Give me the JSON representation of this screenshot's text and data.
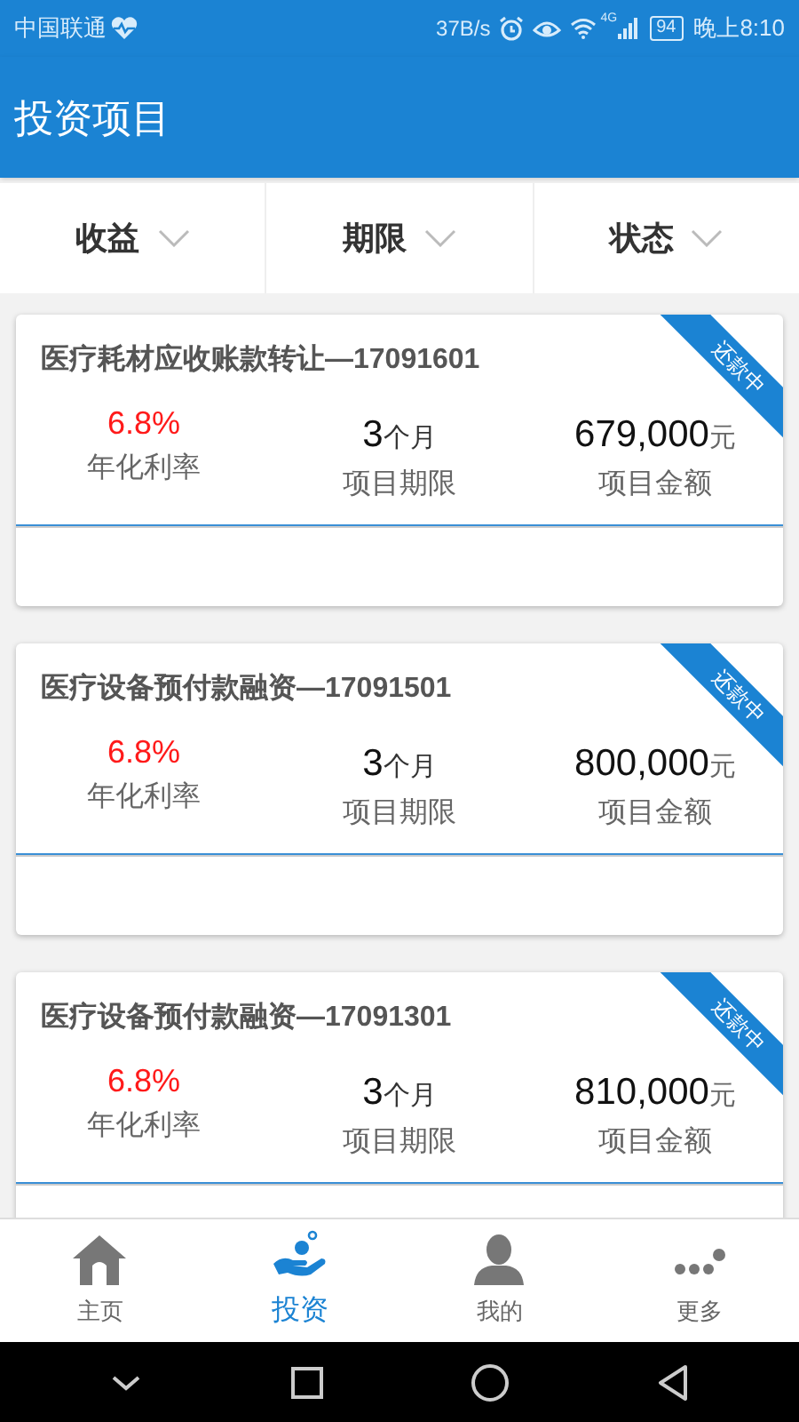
{
  "status_bar": {
    "carrier": "中国联通",
    "speed": "37B/s",
    "network": "4G",
    "battery": "94",
    "time": "晚上8:10"
  },
  "header": {
    "title": "投资项目"
  },
  "filters": [
    {
      "label": "收益"
    },
    {
      "label": "期限"
    },
    {
      "label": "状态"
    }
  ],
  "projects": [
    {
      "title": "医疗耗材应收账款转让—17091601",
      "status": "还款中",
      "rate": "6.8%",
      "rate_label": "年化利率",
      "term": "3",
      "term_unit": "个月",
      "term_label": "项目期限",
      "amount": "679,000",
      "amount_unit": "元",
      "amount_label": "项目金额"
    },
    {
      "title": "医疗设备预付款融资—17091501",
      "status": "还款中",
      "rate": "6.8%",
      "rate_label": "年化利率",
      "term": "3",
      "term_unit": "个月",
      "term_label": "项目期限",
      "amount": "800,000",
      "amount_unit": "元",
      "amount_label": "项目金额"
    },
    {
      "title": "医疗设备预付款融资—17091301",
      "status": "还款中",
      "rate": "6.8%",
      "rate_label": "年化利率",
      "term": "3",
      "term_unit": "个月",
      "term_label": "项目期限",
      "amount": "810,000",
      "amount_unit": "元",
      "amount_label": "项目金额"
    }
  ],
  "bottom_nav": [
    {
      "label": "主页",
      "selected": false
    },
    {
      "label": "投资",
      "selected": true
    },
    {
      "label": "我的",
      "selected": false
    },
    {
      "label": "更多",
      "selected": false
    }
  ]
}
